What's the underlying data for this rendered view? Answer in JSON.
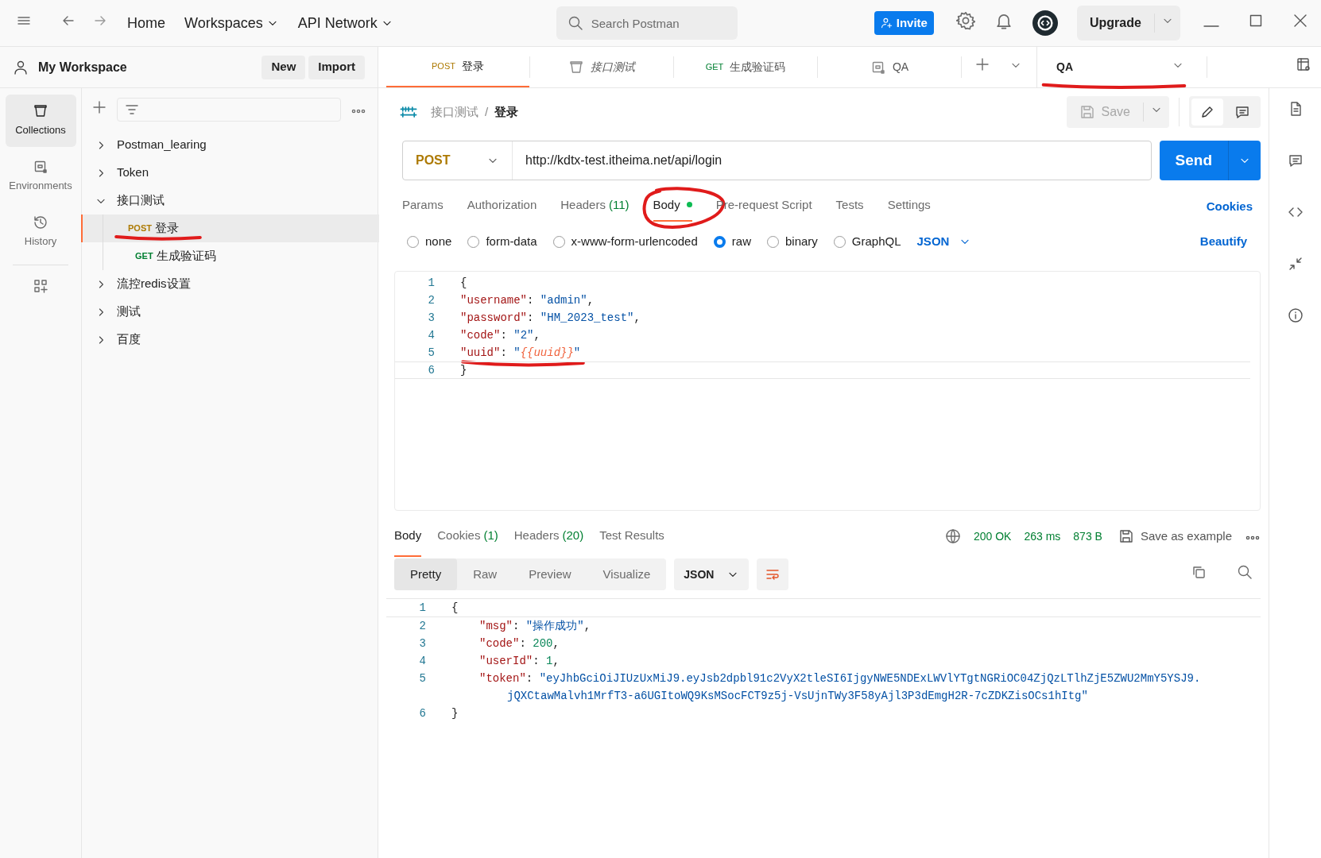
{
  "top_bar": {
    "nav": [
      {
        "label": "Home",
        "dropdown": false
      },
      {
        "label": "Workspaces",
        "dropdown": true
      },
      {
        "label": "API Network",
        "dropdown": true
      }
    ],
    "search": {
      "placeholder": "Search Postman"
    },
    "invite": "Invite",
    "upgrade": "Upgrade"
  },
  "left_rail": [
    {
      "label": "Collections",
      "selected": true
    },
    {
      "label": "Environments",
      "selected": false
    },
    {
      "label": "History",
      "selected": false
    }
  ],
  "sidebar": {
    "title": "My Workspace",
    "buttons": [
      "New",
      "Import"
    ],
    "tree": [
      {
        "label": "Postman_learing",
        "expanded": false
      },
      {
        "label": "Token",
        "expanded": false
      },
      {
        "label": "接口测试",
        "expanded": true,
        "children": [
          {
            "method": "POST",
            "label": "登录",
            "selected": true,
            "underlined": true
          },
          {
            "method": "GET",
            "label": "生成验证码",
            "selected": false
          }
        ]
      },
      {
        "label": "流控redis设置",
        "expanded": false
      },
      {
        "label": "测试",
        "expanded": false
      },
      {
        "label": "百度",
        "expanded": false
      }
    ]
  },
  "tabs": [
    {
      "kind": "request",
      "method": "POST",
      "label": "登录",
      "italic": false,
      "selected": true
    },
    {
      "kind": "collection",
      "label": "接口测试",
      "italic": true,
      "selected": false
    },
    {
      "kind": "request",
      "method": "GET",
      "label": "生成验证码",
      "italic": false,
      "selected": false
    },
    {
      "kind": "environment",
      "label": "QA",
      "italic": false,
      "selected": false
    }
  ],
  "environment": {
    "label": "QA",
    "underlined": true
  },
  "breadcrumb": {
    "parent": "接口测试",
    "separator": "/",
    "current": "登录",
    "save": "Save"
  },
  "request": {
    "method": "POST",
    "url": "http://kdtx-test.itheima.net/api/login",
    "send": "Send",
    "tabs": [
      {
        "label": "Params",
        "selected": false
      },
      {
        "label": "Authorization",
        "selected": false
      },
      {
        "label": "Headers",
        "count": "(11)",
        "selected": false
      },
      {
        "label": "Body",
        "selected": true,
        "dot": true,
        "circled": true
      },
      {
        "label": "Pre-request Script",
        "selected": false
      },
      {
        "label": "Tests",
        "selected": false
      },
      {
        "label": "Settings",
        "selected": false
      }
    ],
    "cookies": "Cookies",
    "body_types": [
      {
        "label": "none",
        "selected": false
      },
      {
        "label": "form-data",
        "selected": false
      },
      {
        "label": "x-www-form-urlencoded",
        "selected": false
      },
      {
        "label": "raw",
        "selected": true
      },
      {
        "label": "binary",
        "selected": false
      },
      {
        "label": "GraphQL",
        "selected": false
      }
    ],
    "format": "JSON",
    "beautify": "Beautify",
    "body_lines": [
      {
        "number": "1",
        "tokens": [
          {
            "kind": "punct",
            "text": "{"
          }
        ]
      },
      {
        "number": "2",
        "tokens": [
          {
            "kind": "key",
            "text": "\"username\""
          },
          {
            "kind": "punct",
            "text": ": "
          },
          {
            "kind": "string",
            "text": "\"admin\""
          },
          {
            "kind": "punct",
            "text": ","
          }
        ]
      },
      {
        "number": "3",
        "tokens": [
          {
            "kind": "key",
            "text": "\"password\""
          },
          {
            "kind": "punct",
            "text": ": "
          },
          {
            "kind": "string",
            "text": "\"HM_2023_test\""
          },
          {
            "kind": "punct",
            "text": ","
          }
        ]
      },
      {
        "number": "4",
        "tokens": [
          {
            "kind": "key",
            "text": "\"code\""
          },
          {
            "kind": "punct",
            "text": ": "
          },
          {
            "kind": "string",
            "text": "\"2\""
          },
          {
            "kind": "punct",
            "text": ","
          }
        ]
      },
      {
        "number": "5",
        "underlined": true,
        "tokens": [
          {
            "kind": "key",
            "text": "\"uuid\""
          },
          {
            "kind": "punct",
            "text": ": "
          },
          {
            "kind": "string",
            "text": "\""
          },
          {
            "kind": "variable",
            "text": "{{uuid}}"
          },
          {
            "kind": "string",
            "text": "\""
          }
        ]
      },
      {
        "number": "6",
        "current": true,
        "tokens": [
          {
            "kind": "punct",
            "text": "}"
          }
        ]
      }
    ]
  },
  "response": {
    "tabs": [
      {
        "label": "Body",
        "selected": true
      },
      {
        "label": "Cookies",
        "count": "(1)",
        "selected": false
      },
      {
        "label": "Headers",
        "count": "(20)",
        "selected": false
      },
      {
        "label": "Test Results",
        "selected": false
      }
    ],
    "status": "200 OK",
    "time": "263 ms",
    "size": "873 B",
    "save_example": "Save as example",
    "views": [
      {
        "label": "Pretty",
        "selected": true
      },
      {
        "label": "Raw",
        "selected": false
      },
      {
        "label": "Preview",
        "selected": false
      },
      {
        "label": "Visualize",
        "selected": false
      }
    ],
    "format": "JSON",
    "lines": [
      {
        "number": "1",
        "indent": false,
        "tokens": [
          {
            "kind": "punct",
            "text": "{"
          }
        ]
      },
      {
        "number": "2",
        "indent": true,
        "tokens": [
          {
            "kind": "key",
            "text": "\"msg\""
          },
          {
            "kind": "punct",
            "text": ": "
          },
          {
            "kind": "string",
            "text": "\"操作成功\""
          },
          {
            "kind": "punct",
            "text": ","
          }
        ]
      },
      {
        "number": "3",
        "indent": true,
        "tokens": [
          {
            "kind": "key",
            "text": "\"code\""
          },
          {
            "kind": "punct",
            "text": ": "
          },
          {
            "kind": "number",
            "text": "200"
          },
          {
            "kind": "punct",
            "text": ","
          }
        ]
      },
      {
        "number": "4",
        "indent": true,
        "tokens": [
          {
            "kind": "key",
            "text": "\"userId\""
          },
          {
            "kind": "punct",
            "text": ": "
          },
          {
            "kind": "number",
            "text": "1"
          },
          {
            "kind": "punct",
            "text": ","
          }
        ]
      },
      {
        "number": "5",
        "indent": true,
        "tokens": [
          {
            "kind": "key",
            "text": "\"token\""
          },
          {
            "kind": "punct",
            "text": ": "
          },
          {
            "kind": "string",
            "text": "\"eyJhbGciOiJIUzUxMiJ9.eyJsb2dpbl91c2VyX2tleSI6IjgyNWE5NDExLWVlYTgtNGRiOC04ZjQzLTlhZjE5ZWU2MmY5YSJ9."
          }
        ],
        "continuation": "jQXCtawMalvh1MrfT3-a6UGItoWQ9KsMSocFCT9z5j-VsUjnTWy3F58yAjl3P3dEmgH2R-7cZDKZisOCs1hItg\""
      },
      {
        "number": "6",
        "indent": false,
        "tokens": [
          {
            "kind": "punct",
            "text": "}"
          }
        ]
      }
    ]
  }
}
